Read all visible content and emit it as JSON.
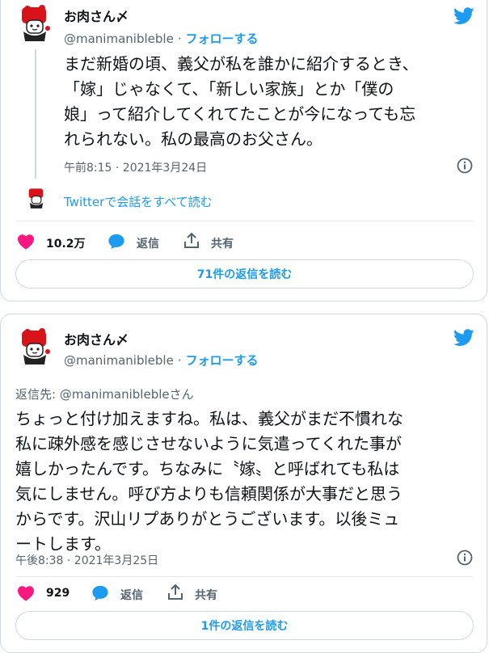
{
  "colors": {
    "accent": "#1d9bf0",
    "like": "#f91880",
    "text": "#0f1419",
    "muted": "#536471"
  },
  "tweet1": {
    "name": "お肉さん〆",
    "handle": "@manimanibleble",
    "follow_label": "フォローする",
    "text_lines": [
      "まだ新婚の頃、義父が私を誰かに紹介するとき、",
      "「嫁」じゃなくて、「新しい家族」とか「僕の",
      "娘」って紹介してくれてたことが今になっても忘",
      "れられない。私の最高のお父さん。"
    ],
    "timestamp": "午前8:15 · 2021年3月24日",
    "thread_link": "Twitterで会話をすべて読む",
    "likes": "10.2万",
    "reply_label": "返信",
    "share_label": "共有",
    "read_replies": "71件の返信を読む"
  },
  "tweet2": {
    "name": "お肉さん〆",
    "handle": "@manimanibleble",
    "follow_label": "フォローする",
    "reply_to_prefix": "返信先: ",
    "reply_to_handle": "@manimanibleble",
    "reply_to_suffix": "さん",
    "text_lines": [
      "ちょっと付け加えますね。私は、義父がまだ不慣れな",
      "私に疎外感を感じさせないように気遣ってくれた事が",
      "嬉しかったんです。ちなみに〝嫁〟と呼ばれても私は",
      "気にしません。呼び方よりも信頼関係が大事だと思う",
      "からです。沢山リプありがとうございます。以後ミュ",
      "ートします。"
    ],
    "timestamp": "午後8:38 · 2021年3月25日",
    "likes": "929",
    "reply_label": "返信",
    "share_label": "共有",
    "read_replies": "1件の返信を読む"
  },
  "icons": [
    "twitter-bird-icon",
    "info-icon",
    "heart-icon",
    "reply-icon",
    "share-icon",
    "avatar"
  ]
}
